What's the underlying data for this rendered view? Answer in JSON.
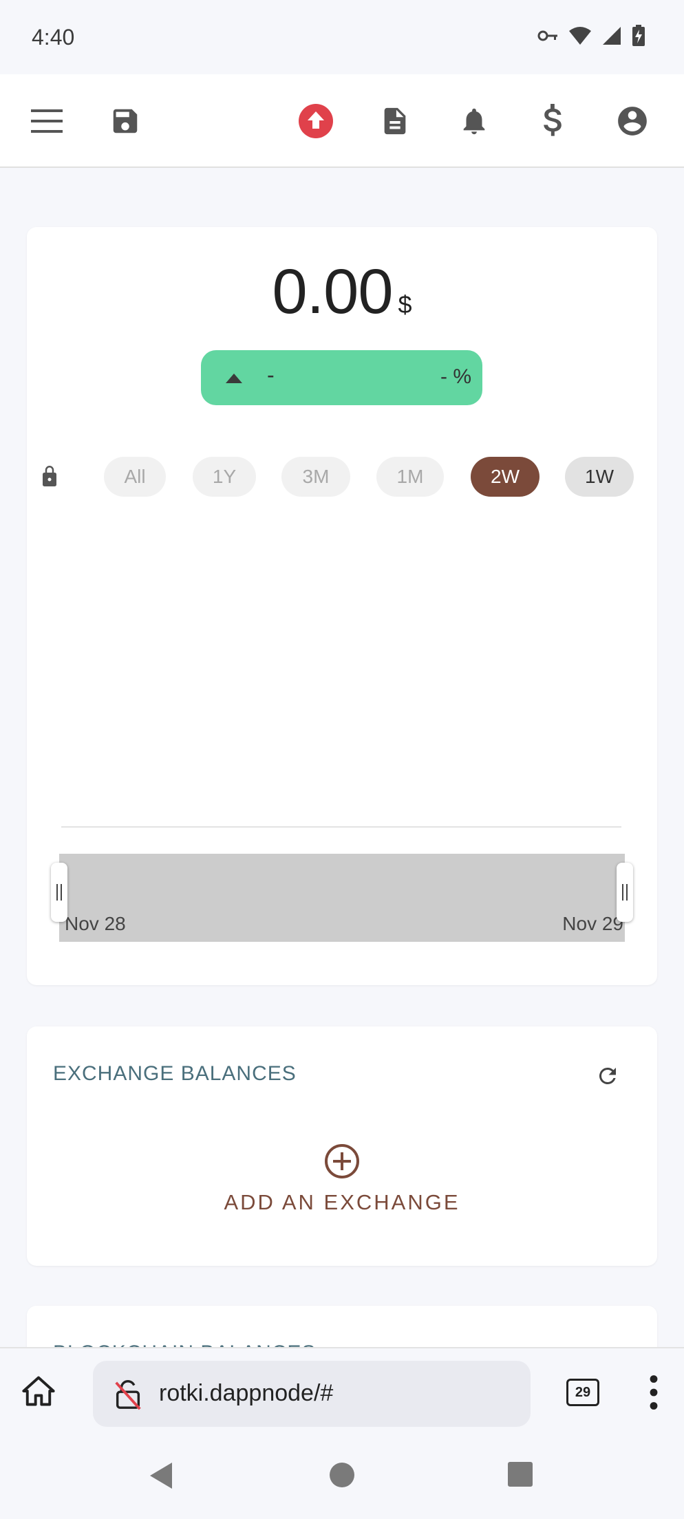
{
  "status_bar": {
    "time": "4:40",
    "icons": [
      "vpn-key-icon",
      "wifi-icon",
      "signal-icon",
      "battery-charging-icon"
    ]
  },
  "app_bar": {
    "icons": [
      "menu-icon",
      "save-icon",
      "upgrade-arrow-icon",
      "notes-icon",
      "notifications-icon",
      "currency-dollar-icon",
      "account-icon"
    ],
    "accent_color": "#e0414b"
  },
  "overview": {
    "total_amount": "0.00",
    "currency_symbol": "$",
    "change_value": "-",
    "change_percent": "- %",
    "change_color": "#62d6a1",
    "ranges": [
      "All",
      "1Y",
      "3M",
      "1M",
      "2W",
      "1W"
    ],
    "active_range": "2W",
    "range_active_color": "#7b4a3a",
    "zoom": {
      "start_label": "Nov 28",
      "end_label": "Nov 29"
    }
  },
  "exchange_balances": {
    "title": "EXCHANGE BALANCES",
    "add_label": "ADD AN EXCHANGE"
  },
  "blockchain_balances": {
    "title": "BLOCKCHAIN BALANCES"
  },
  "browser": {
    "url": "rotki.dappnode/#",
    "tab_count": "29"
  }
}
